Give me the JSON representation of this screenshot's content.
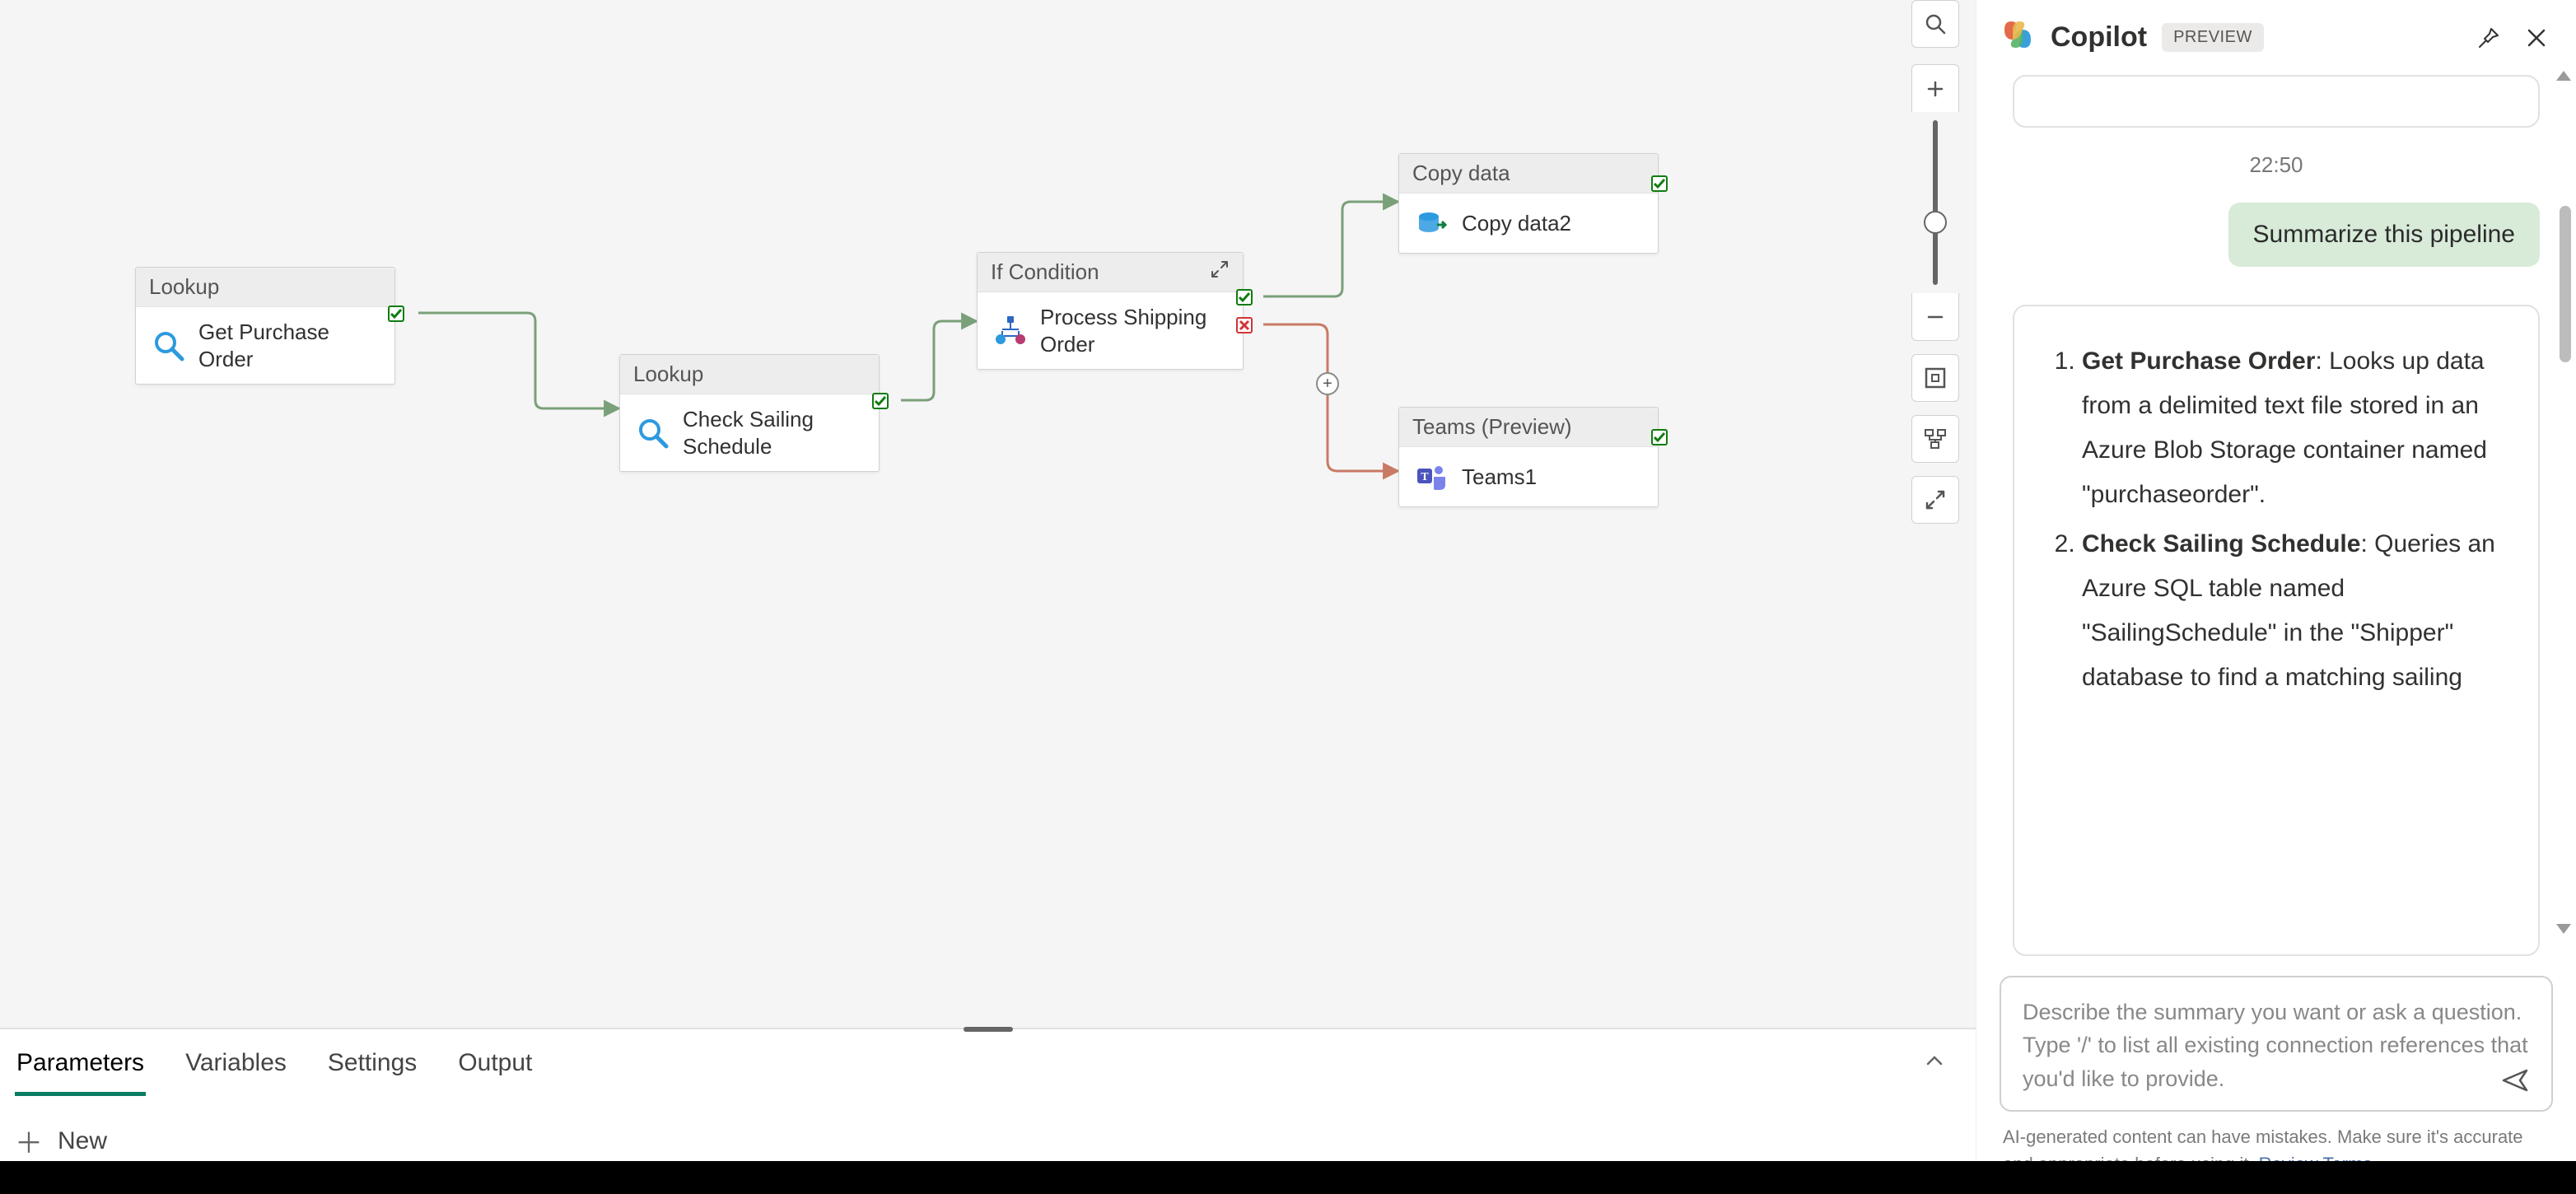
{
  "canvas": {
    "nodes": {
      "lookup1": {
        "type": "Lookup",
        "name": "Get Purchase Order"
      },
      "lookup2": {
        "type": "Lookup",
        "name": "Check Sailing\nSchedule"
      },
      "ifcond": {
        "type": "If Condition",
        "name": "Process Shipping\nOrder"
      },
      "copy": {
        "type": "Copy data",
        "name": "Copy data2"
      },
      "teams": {
        "type": "Teams (Preview)",
        "name": "Teams1"
      }
    }
  },
  "toolbox": {
    "search": "Search",
    "zoom_in": "Zoom in",
    "zoom_out": "Zoom out",
    "fit": "Fit to screen",
    "layout": "Auto layout",
    "fullscreen": "Full screen"
  },
  "bottom_panel": {
    "tabs": [
      "Parameters",
      "Variables",
      "Settings",
      "Output"
    ],
    "active_tab_index": 0,
    "new_label": "New"
  },
  "copilot": {
    "title": "Copilot",
    "badge": "PREVIEW",
    "timestamp": "22:50",
    "user_message": "Summarize this pipeline",
    "assistant_items": [
      {
        "title": "Get Purchase Order",
        "text": ": Looks up data from a delimited text file stored in an Azure Blob Storage container named \"purchaseorder\"."
      },
      {
        "title": "Check Sailing Schedule",
        "text": ": Queries an Azure SQL table named \"SailingSchedule\" in the \"Shipper\" database to find a matching sailing"
      }
    ],
    "input_placeholder": "Describe the summary you want or ask a question.\nType '/' to list all existing connection references that you'd like to provide.",
    "disclaimer_text": "AI-generated content can have mistakes. Make sure it's accurate and appropriate before using it. ",
    "disclaimer_link": "Review Terms"
  }
}
